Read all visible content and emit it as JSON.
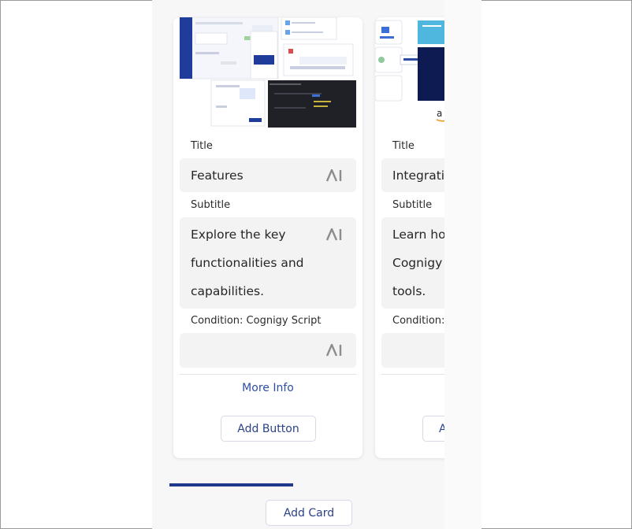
{
  "cards": [
    {
      "title_label": "Title",
      "title_value": "Features",
      "subtitle_label": "Subtitle",
      "subtitle_value": "Explore the key functionalities and capabilities.",
      "condition_label": "Condition: Cognigy Script",
      "condition_value": "",
      "more_info": "More Info",
      "add_button": "Add Button"
    },
    {
      "title_label": "Title",
      "title_value": "Integratio",
      "subtitle_label": "Subtitle",
      "subtitle_value": "Learn ho Cognigy tools.",
      "condition_label": "Condition: C",
      "condition_value": "",
      "add_button": "A"
    }
  ],
  "carousel_progress": 0.42,
  "add_card": "Add Card",
  "colors": {
    "accent": "#1f3a8a",
    "link": "#2d4ea5",
    "field_bg": "#f3f3f4"
  }
}
